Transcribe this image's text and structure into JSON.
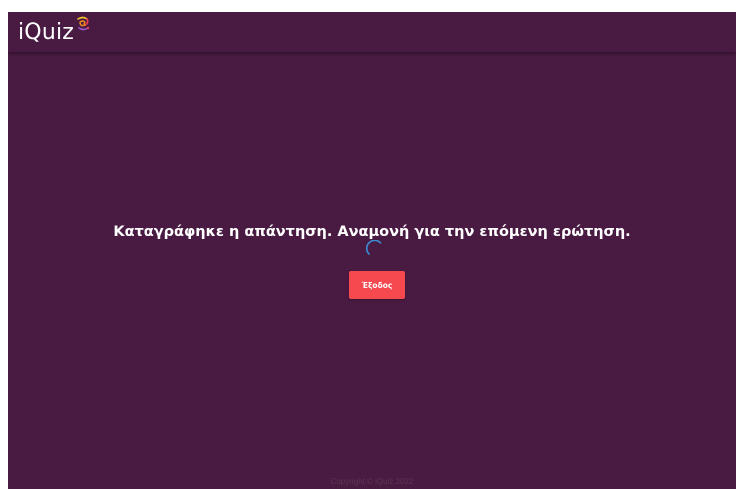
{
  "header": {
    "app_name": "iQuiz",
    "logo_icon": "swirl-logo-icon"
  },
  "main": {
    "status_message": "Καταγράφηκε η απάντηση. Αναμονή για την επόμενη ερώτηση.",
    "spinner_icon": "loading-spinner-icon",
    "exit_label": "Έξοδος"
  },
  "footer": {
    "copyright": "Copyright © iQuiz 2022"
  },
  "colors": {
    "background": "#4a1b42",
    "button": "#f5484f",
    "spinner": "#3b8fd6",
    "text": "#ffffff"
  }
}
